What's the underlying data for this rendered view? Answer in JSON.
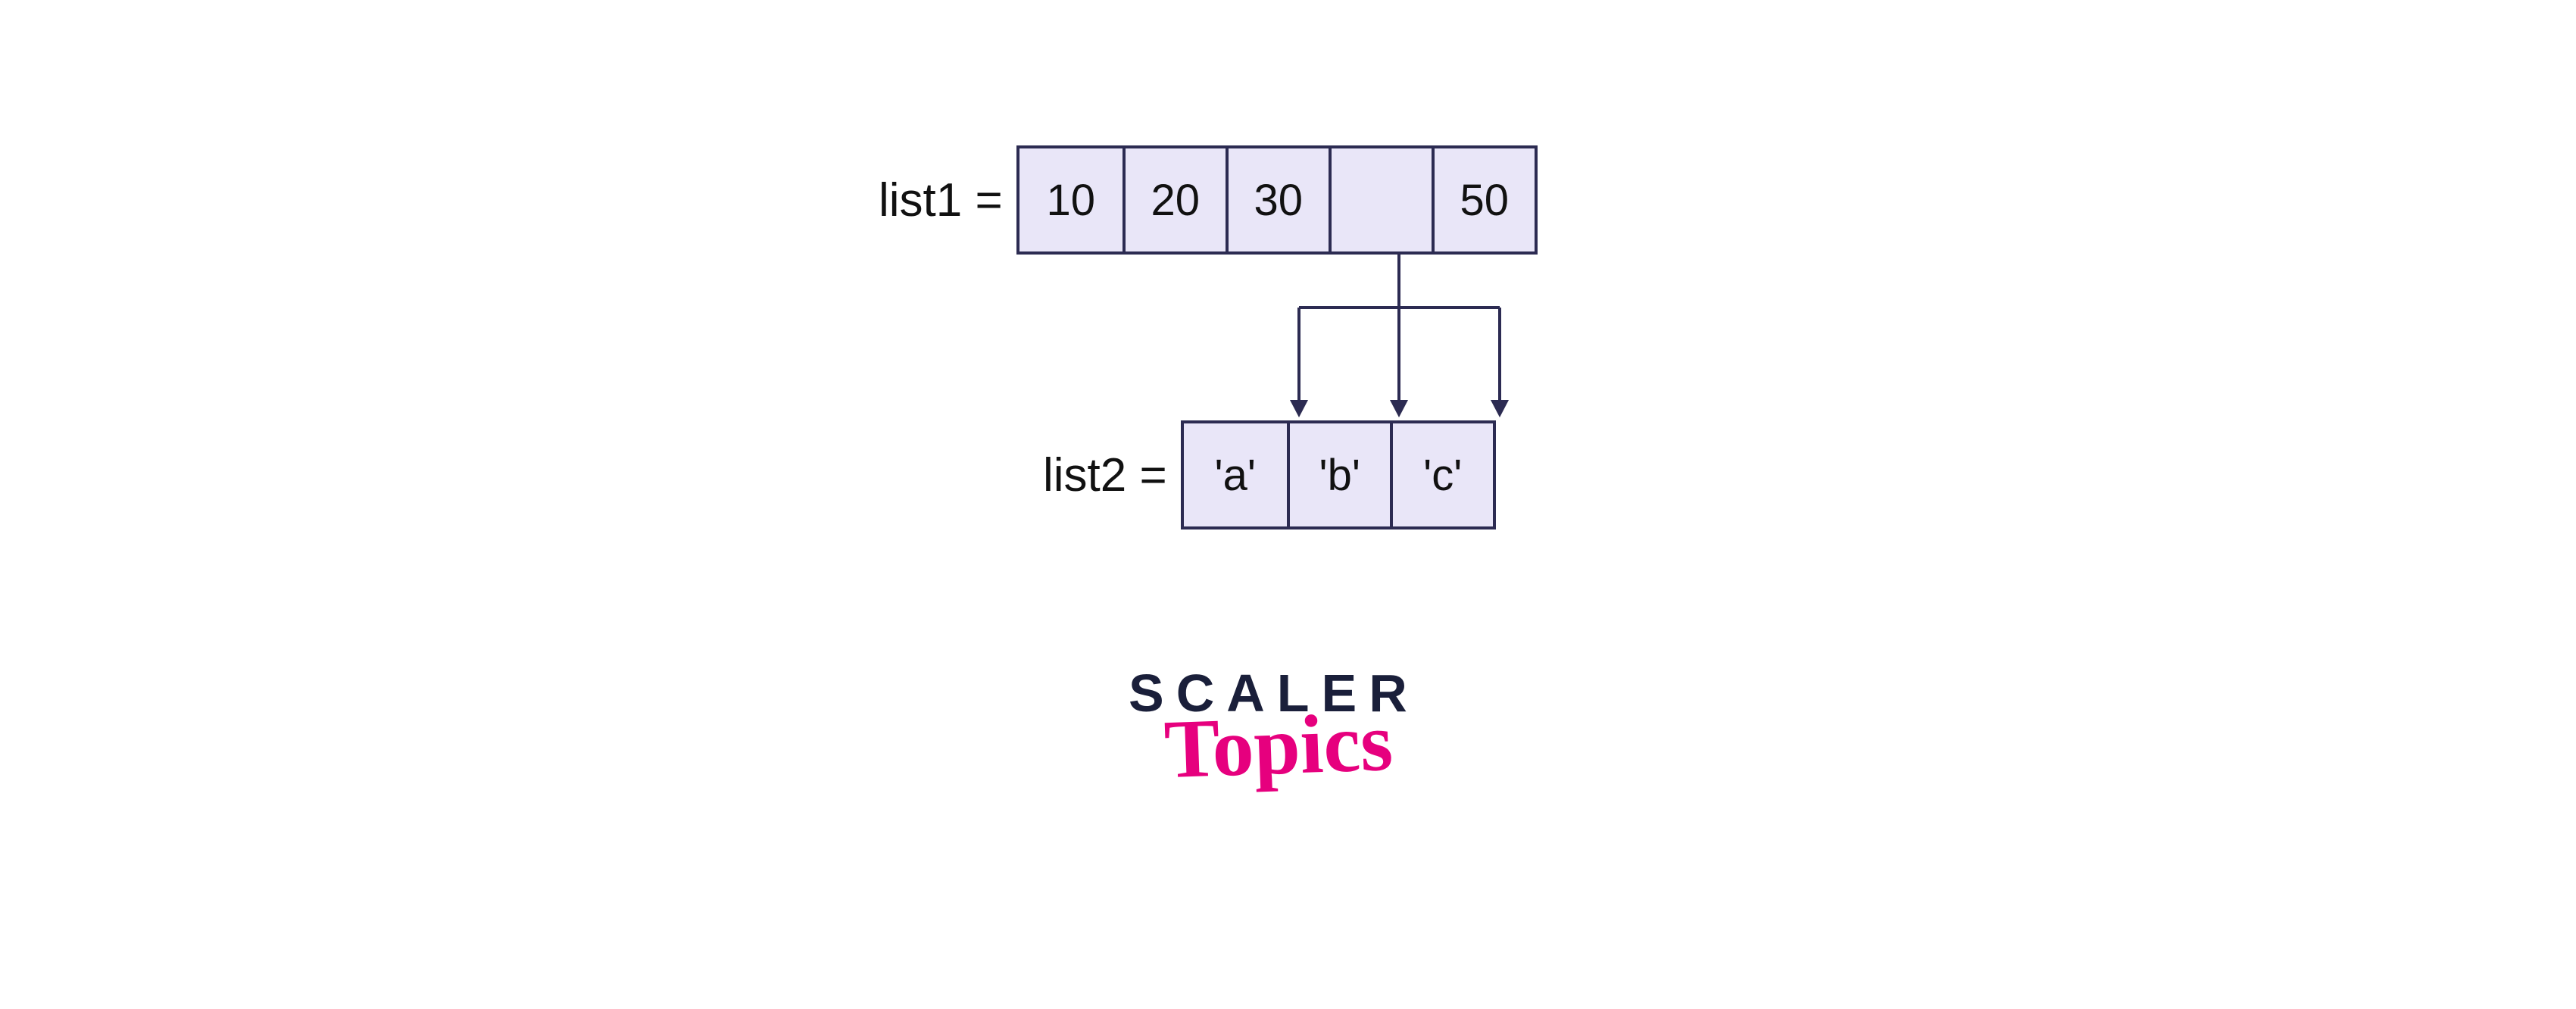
{
  "list1": {
    "label": "list1 =",
    "cells": [
      "10",
      "20",
      "30",
      "",
      "50"
    ]
  },
  "list2": {
    "label": "list2 =",
    "cells": [
      "'a'",
      "'b'",
      "'c'"
    ]
  },
  "logo": {
    "top": "SCALER",
    "bottom": "Topics"
  },
  "colors": {
    "cell_fill": "#e9e6f8",
    "cell_border": "#2c2b52",
    "logo_dark": "#1a1f3a",
    "logo_pink": "#e6007e"
  }
}
